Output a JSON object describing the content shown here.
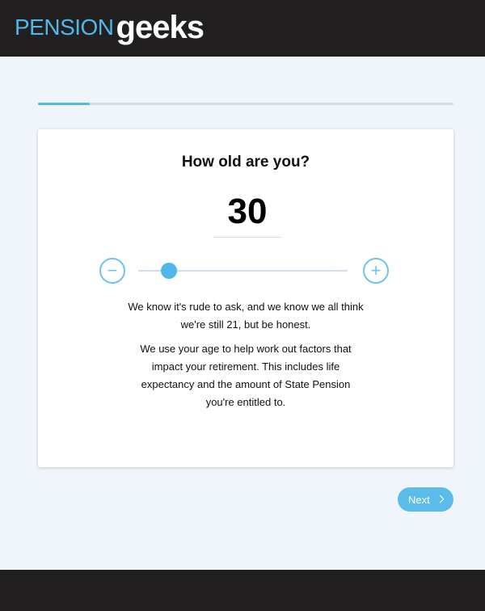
{
  "brand": {
    "logo_pension": "PENSION",
    "logo_geeks": "geeks",
    "colors": {
      "accent": "#4fb8e8",
      "dark": "#221f20",
      "background": "#f0f5fb"
    }
  },
  "progress": {
    "fraction": 0.125
  },
  "question": {
    "title": "How old are you?",
    "age_value": "30",
    "slider": {
      "min": 18,
      "max": 100,
      "value": 30
    },
    "decrease_label": "−",
    "increase_label": "+",
    "paragraph1": "We know it's rude to ask, and we know we all think we're still 21, but be honest.",
    "paragraph2": "We use your age to help work out factors that impact your retirement. This includes life expectancy and the amount of State Pension you're entitled to."
  },
  "navigation": {
    "next_label": "Next",
    "next_icon": "chevron-right-icon"
  }
}
